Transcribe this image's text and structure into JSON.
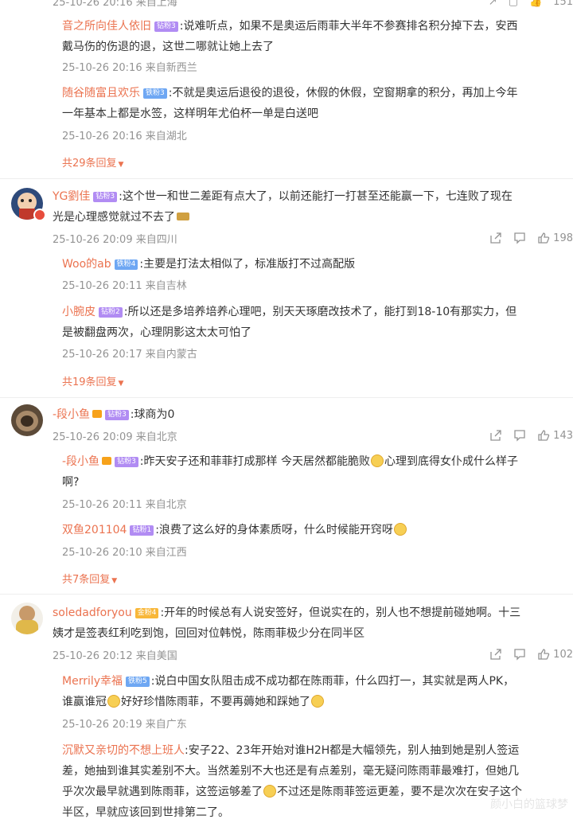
{
  "top_cut_meta": "25-10-26 20:16 来自上海",
  "top_cut_count": "151",
  "threads": [
    {
      "replies": [
        {
          "nick": "音之所向佳人依旧",
          "badge": "钻粉3",
          "text_l1": ":说难听点，如果不是奥运后雨菲大半年不参赛排名积分掉下去，安西",
          "text_l2": "戴马伤的伤退的退，这世二哪就让她上去了",
          "time": "25-10-26 20:16",
          "loc": "来自新西兰"
        },
        {
          "nick": "随谷随富且欢乐",
          "badge": "铁粉3",
          "text_l1": ":不就是奥运后退役的退役，休假的休假，空窗期拿的积分，再加上今年",
          "text_l2": "一年基本上都是水签，这样明年尤伯杯一单是白送吧",
          "time": "25-10-26 20:16",
          "loc": "来自湖北"
        }
      ],
      "more": "共29条回复"
    },
    {
      "author": {
        "nick": "YG劉佳",
        "badge": "钻粉3",
        "text_l1": ":这个世一和世二差距有点大了，以前还能打一打甚至还能赢一下，七连败了现在",
        "text_l2": "光是心理感觉就过不去了",
        "time": "25-10-26 20:09",
        "loc": "来自四川",
        "likes": "198"
      },
      "replies": [
        {
          "nick": "Woo的ab",
          "badge": "铁粉4",
          "text_l1": ":主要是打法太相似了，标准版打不过高配版",
          "time": "25-10-26 20:11",
          "loc": "来自吉林"
        },
        {
          "nick": "小腕皮",
          "badge": "钻粉2",
          "text_l1": ":所以还是多培养培养心理吧，别天天琢磨改技术了，能打到18-10有那实力，但",
          "text_l2": "是被翻盘两次，心理阴影这太太可怕了",
          "time": "25-10-26 20:17",
          "loc": "来自内蒙古"
        }
      ],
      "more": "共19条回复"
    },
    {
      "author": {
        "nick": "-段小鱼",
        "badge": "钻粉3",
        "text_l1": ":球商为0",
        "time": "25-10-26 20:09",
        "loc": "来自北京",
        "likes": "143"
      },
      "replies": [
        {
          "nick": "-段小鱼",
          "badge": "钻粉3",
          "text_l1a": ":昨天安子还和菲菲打成那样 今天居然都能脆败",
          "text_l1b": "心理到底得女仆成什么样子",
          "text_l2": "啊?",
          "time": "25-10-26 20:11",
          "loc": "来自北京"
        },
        {
          "nick": "双鱼201104",
          "badge": "钻粉1",
          "text_l1": ":浪费了这么好的身体素质呀，什么时候能开窍呀",
          "time": "25-10-26 20:10",
          "loc": "来自江西"
        }
      ],
      "more": "共7条回复"
    },
    {
      "author": {
        "nick": "soledadforyou",
        "badge": "金粉4",
        "text_l1": ":开年的时候总有人说安签好，但说实在的，别人也不想提前碰她啊。十三",
        "text_l2": "姨才是签表红利吃到饱，回回对位韩悦，陈雨菲极少分在同半区",
        "time": "25-10-26 20:12",
        "loc": "来自美国",
        "likes": "102"
      },
      "replies": [
        {
          "nick": "Merrily幸福",
          "badge": "铁粉5",
          "text_l1": ":说白中国女队阻击成不成功都在陈雨菲，什么四打一，其实就是两人PK，",
          "text_l2a": "谁赢谁冠",
          "text_l2b": "好好珍惜陈雨菲，不要再薅她和踩她了",
          "time": "25-10-26 20:19",
          "loc": "来自广东"
        },
        {
          "nick": "沉默又亲切的不想上班人",
          "text_l1": ":安子22、23年开始对谁H2H都是大幅领先，别人抽到她是别人签运",
          "text_l2": "差，她抽到谁其实差别不大。当然差别不大也还是有点差别，毫无疑问陈雨菲最难打，但她几",
          "text_l3a": "乎次次最早就遇到陈雨菲，这签运够差了",
          "text_l3b": "不过还是陈雨菲签运更差，要不是次次在安子这个",
          "text_l4": "半区，早就应该回到世排第二了。"
        }
      ]
    }
  ],
  "watermark": "颜小白的篮球梦"
}
